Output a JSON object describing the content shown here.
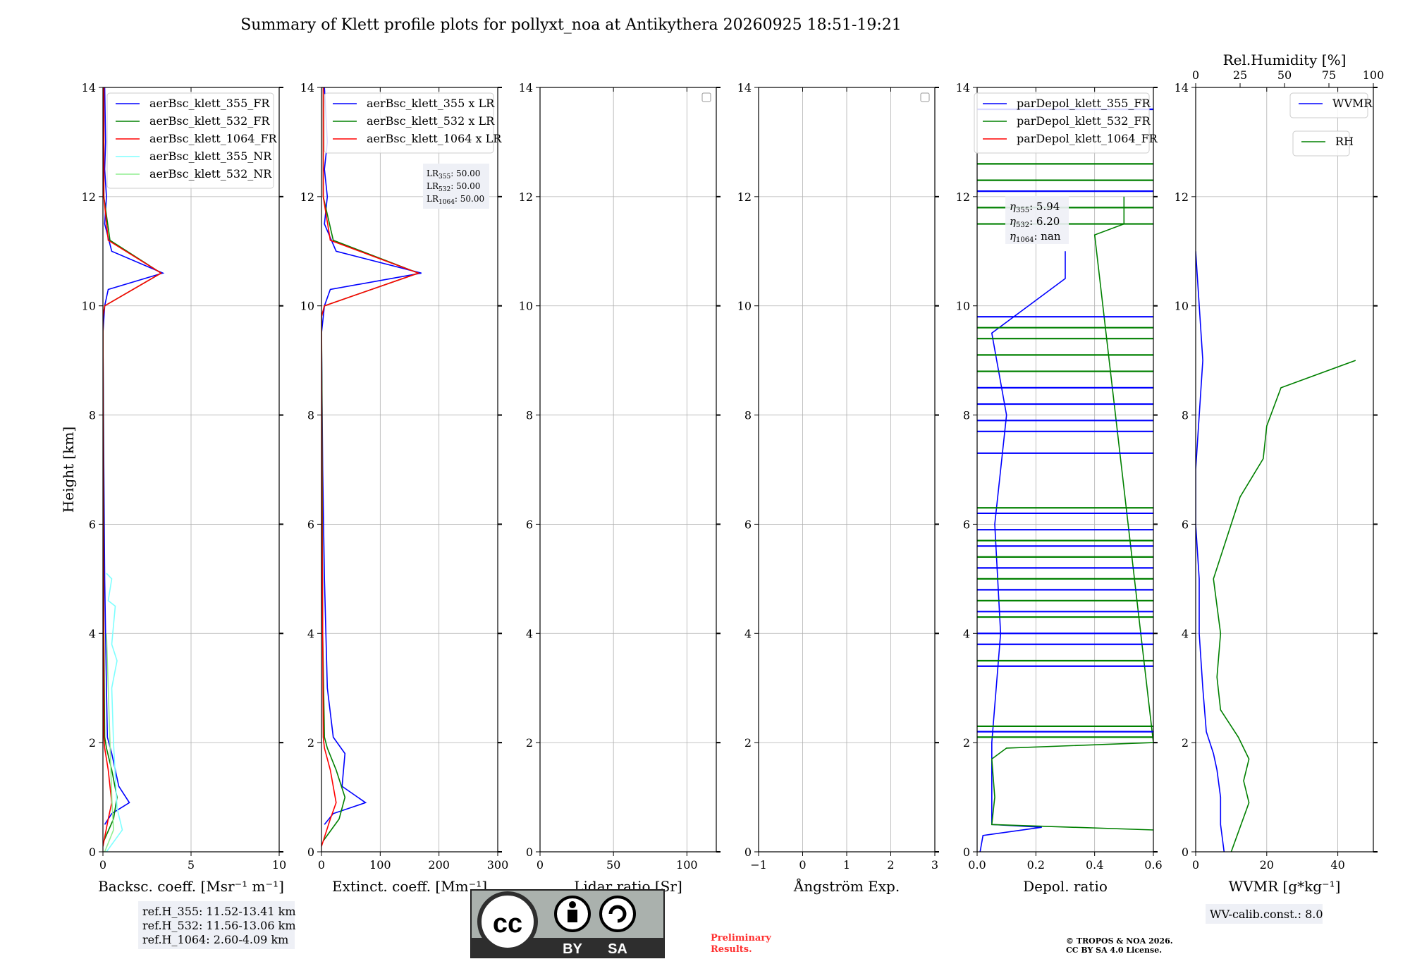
{
  "title": "Summary of Klett profile plots for pollyxt_noa at Antikythera 20260925 18:51-19:21",
  "height_label": "Height [km]",
  "height_ticks": [
    "0",
    "2",
    "4",
    "6",
    "8",
    "10",
    "12",
    "14"
  ],
  "panels": [
    {
      "id": "bsc",
      "xlabel": "Backsc. coeff. [Msr⁻¹ m⁻¹]",
      "xticks": [
        "0",
        "5",
        "10"
      ],
      "xlim": [
        0,
        10
      ]
    },
    {
      "id": "ext",
      "xlabel": "Extinct. coeff. [Mm⁻¹]",
      "xticks": [
        "0",
        "100",
        "200",
        "300"
      ],
      "xlim": [
        0,
        300
      ]
    },
    {
      "id": "lr",
      "xlabel": "Lidar ratio [Sr]",
      "xticks": [
        "0",
        "50",
        "100"
      ],
      "xlim": [
        0,
        120
      ]
    },
    {
      "id": "ang",
      "xlabel": "Ångström Exp.",
      "xticks": [
        "−1",
        "0",
        "1",
        "2",
        "3"
      ],
      "xlim": [
        -1,
        3
      ]
    },
    {
      "id": "dep",
      "xlabel": "Depol. ratio",
      "xticks": [
        "0.0",
        "0.2",
        "0.4",
        "0.6"
      ],
      "xlim": [
        0,
        0.6
      ]
    },
    {
      "id": "wv",
      "xlabel": "WVMR [g*kg⁻¹]",
      "xticks": [
        "0",
        "20",
        "40"
      ],
      "xlim": [
        0,
        50
      ],
      "top_label": "Rel.Humidity [%]",
      "top_ticks": [
        "0",
        "25",
        "50",
        "75",
        "100"
      ],
      "top_lim": [
        0,
        100
      ]
    }
  ],
  "legends": {
    "bsc": [
      "aerBsc_klett_355_FR",
      "aerBsc_klett_532_FR",
      "aerBsc_klett_1064_FR",
      "aerBsc_klett_355_NR",
      "aerBsc_klett_532_NR"
    ],
    "ext": [
      "aerBsc_klett_355 x LR",
      "aerBsc_klett_532 x LR",
      "aerBsc_klett_1064 x LR"
    ],
    "dep": [
      "parDepol_klett_355_FR",
      "parDepol_klett_532_FR",
      "parDepol_klett_1064_FR"
    ],
    "wv_wvmr": "WVMR",
    "wv_rh": "RH"
  },
  "annotations": {
    "lr355": "50.00",
    "lr532": "50.00",
    "lr1064": "50.00",
    "eta355": "5.94",
    "eta532": "6.20",
    "eta1064": "nan",
    "ref_355": "ref.H_355: 11.52-13.41 km",
    "ref_532": "ref.H_532: 11.56-13.06 km",
    "ref_1064": "ref.H_1064: 2.60-4.09 km",
    "wv_calib": "WV-calib.const.: 8.0",
    "preliminary_1": "Preliminary",
    "preliminary_2": "Results.",
    "copyright_1": "© TROPOS & NOA 2026.",
    "copyright_2": "CC BY SA 4.0 License.",
    "cc_by": "BY",
    "cc_sa": "SA"
  },
  "colors": {
    "c355": "#0000ff",
    "c532": "#008000",
    "c1064": "#ff0000",
    "c355nr": "#7fffff",
    "c532nr": "#90ee90",
    "preliminary": "#ff3030"
  },
  "chart_data": [
    {
      "type": "line",
      "panel": "bsc",
      "ylim": [
        0,
        14
      ],
      "xlim": [
        0,
        10
      ],
      "series": [
        {
          "name": "aerBsc_klett_355_FR",
          "x": [
            0.1,
            0.5,
            1.5,
            0.9,
            0.5,
            0.25,
            0.2,
            0.1,
            0.05,
            0.0,
            0.1,
            0.3,
            3.4,
            0.5,
            0.1,
            0.2,
            0.1,
            0.15,
            0.1
          ],
          "y": [
            0.5,
            0.7,
            0.9,
            1.2,
            1.8,
            2.1,
            3.0,
            5.0,
            7.0,
            9.5,
            10.0,
            10.3,
            10.6,
            11.0,
            11.5,
            12.0,
            12.5,
            13.0,
            14.0
          ]
        },
        {
          "name": "aerBsc_klett_532_FR",
          "x": [
            0.05,
            0.6,
            0.8,
            0.5,
            0.2,
            0.1,
            0.05,
            0.02,
            0.0,
            0.1,
            3.3,
            0.4,
            0.05,
            0.05
          ],
          "y": [
            0.2,
            0.6,
            1.0,
            1.5,
            1.9,
            2.1,
            4.0,
            8.0,
            9.8,
            10.0,
            10.6,
            11.2,
            12.0,
            14.0
          ]
        },
        {
          "name": "aerBsc_klett_1064_FR",
          "x": [
            0.0,
            0.3,
            0.5,
            0.3,
            0.1,
            0.05,
            0.02,
            0.0,
            0.1,
            3.3,
            0.3,
            0.05,
            0.05
          ],
          "y": [
            0.1,
            0.6,
            0.9,
            1.5,
            1.9,
            2.1,
            6.0,
            9.8,
            10.0,
            10.6,
            11.2,
            12.0,
            14.0
          ]
        },
        {
          "name": "aerBsc_klett_355_NR",
          "x": [
            0.2,
            1.1,
            0.8,
            0.6,
            0.5,
            0.8,
            0.5,
            0.7,
            0.3,
            0.5,
            0.2
          ],
          "y": [
            0.0,
            0.4,
            0.8,
            2.0,
            3.0,
            3.5,
            3.8,
            4.5,
            4.6,
            5.0,
            5.1
          ]
        },
        {
          "name": "aerBsc_klett_532_NR",
          "x": [
            0.1,
            0.6,
            0.5,
            0.4,
            0.3,
            0.2
          ],
          "y": [
            0.0,
            0.4,
            1.0,
            2.0,
            3.0,
            4.0
          ]
        }
      ]
    },
    {
      "type": "line",
      "panel": "ext",
      "ylim": [
        0,
        14
      ],
      "xlim": [
        0,
        300
      ],
      "series": [
        {
          "name": "aerBsc_klett_355 x LR",
          "x": [
            5,
            20,
            75,
            35,
            40,
            20,
            10,
            5,
            2,
            0,
            5,
            15,
            170,
            25,
            5,
            10,
            5,
            10,
            5
          ],
          "y": [
            0.5,
            0.7,
            0.9,
            1.2,
            1.8,
            2.1,
            3.0,
            5.0,
            7.0,
            9.5,
            10.0,
            10.3,
            10.6,
            11.0,
            11.5,
            12.0,
            12.5,
            13.0,
            14.0
          ]
        },
        {
          "name": "aerBsc_klett_532 x LR",
          "x": [
            3,
            30,
            40,
            25,
            10,
            5,
            2,
            1,
            0,
            5,
            165,
            20,
            3,
            3
          ],
          "y": [
            0.2,
            0.6,
            1.0,
            1.5,
            1.9,
            2.1,
            4.0,
            8.0,
            9.8,
            10.0,
            10.6,
            11.2,
            12.0,
            14.0
          ]
        },
        {
          "name": "aerBsc_klett_1064 x LR",
          "x": [
            0,
            15,
            25,
            15,
            5,
            3,
            1,
            0,
            5,
            165,
            15,
            3,
            3
          ],
          "y": [
            0.1,
            0.6,
            0.9,
            1.5,
            1.9,
            2.1,
            6.0,
            9.8,
            10.0,
            10.6,
            11.2,
            12.0,
            14.0
          ]
        }
      ]
    },
    {
      "type": "line",
      "panel": "lr",
      "ylim": [
        0,
        14
      ],
      "xlim": [
        0,
        120
      ],
      "series": []
    },
    {
      "type": "line",
      "panel": "ang",
      "ylim": [
        0,
        14
      ],
      "xlim": [
        -1,
        3
      ],
      "series": []
    },
    {
      "type": "line",
      "panel": "dep",
      "ylim": [
        0,
        14
      ],
      "xlim": [
        0,
        0.6
      ],
      "series": [
        {
          "name": "parDepol_klett_355_FR",
          "x": [
            0.01,
            0.02,
            0.22,
            0.05,
            0.05,
            0.08,
            0.06,
            0.1,
            0.05,
            0.3,
            0.3
          ],
          "y": [
            0.0,
            0.3,
            0.45,
            0.5,
            2.0,
            4.0,
            6.0,
            8.0,
            9.5,
            10.5,
            11.0
          ]
        },
        {
          "name": "parDepol_klett_532_FR",
          "x": [
            0.6,
            0.05,
            0.06,
            0.05,
            0.1,
            0.6,
            0.4,
            0.5,
            0.5
          ],
          "y": [
            0.4,
            0.5,
            1.0,
            1.7,
            1.9,
            2.0,
            11.3,
            11.5,
            12.0
          ]
        }
      ],
      "spikes_355": [
        2.2,
        3.4,
        3.8,
        4.0,
        4.4,
        4.8,
        5.2,
        5.6,
        5.9,
        6.2,
        7.3,
        7.7,
        7.9,
        8.2,
        8.5,
        9.8,
        12.1,
        13.6
      ],
      "spikes_532": [
        2.1,
        2.3,
        3.5,
        4.3,
        4.6,
        5.0,
        5.4,
        5.7,
        6.3,
        8.8,
        9.1,
        9.4,
        9.6,
        11.5,
        11.8,
        12.3,
        12.6
      ]
    },
    {
      "type": "line",
      "panel": "wv",
      "ylim": [
        0,
        14
      ],
      "xlim": [
        0,
        50
      ],
      "series": [
        {
          "name": "WVMR",
          "x": [
            8,
            7,
            7,
            6,
            5,
            3,
            2,
            1,
            1,
            0,
            0,
            2,
            0
          ],
          "y": [
            0.0,
            0.5,
            1.0,
            1.5,
            1.8,
            2.2,
            3.0,
            4.0,
            5.0,
            6.0,
            7.0,
            9.0,
            11.0
          ]
        },
        {
          "name": "RH",
          "x": [
            20,
            30,
            27,
            30,
            24,
            14,
            12,
            14,
            10,
            20,
            25,
            38,
            40,
            48,
            90
          ],
          "y": [
            0.0,
            0.9,
            1.3,
            1.7,
            2.1,
            2.6,
            3.2,
            4.0,
            5.0,
            6.0,
            6.5,
            7.2,
            7.8,
            8.5,
            9.0
          ]
        }
      ]
    }
  ]
}
